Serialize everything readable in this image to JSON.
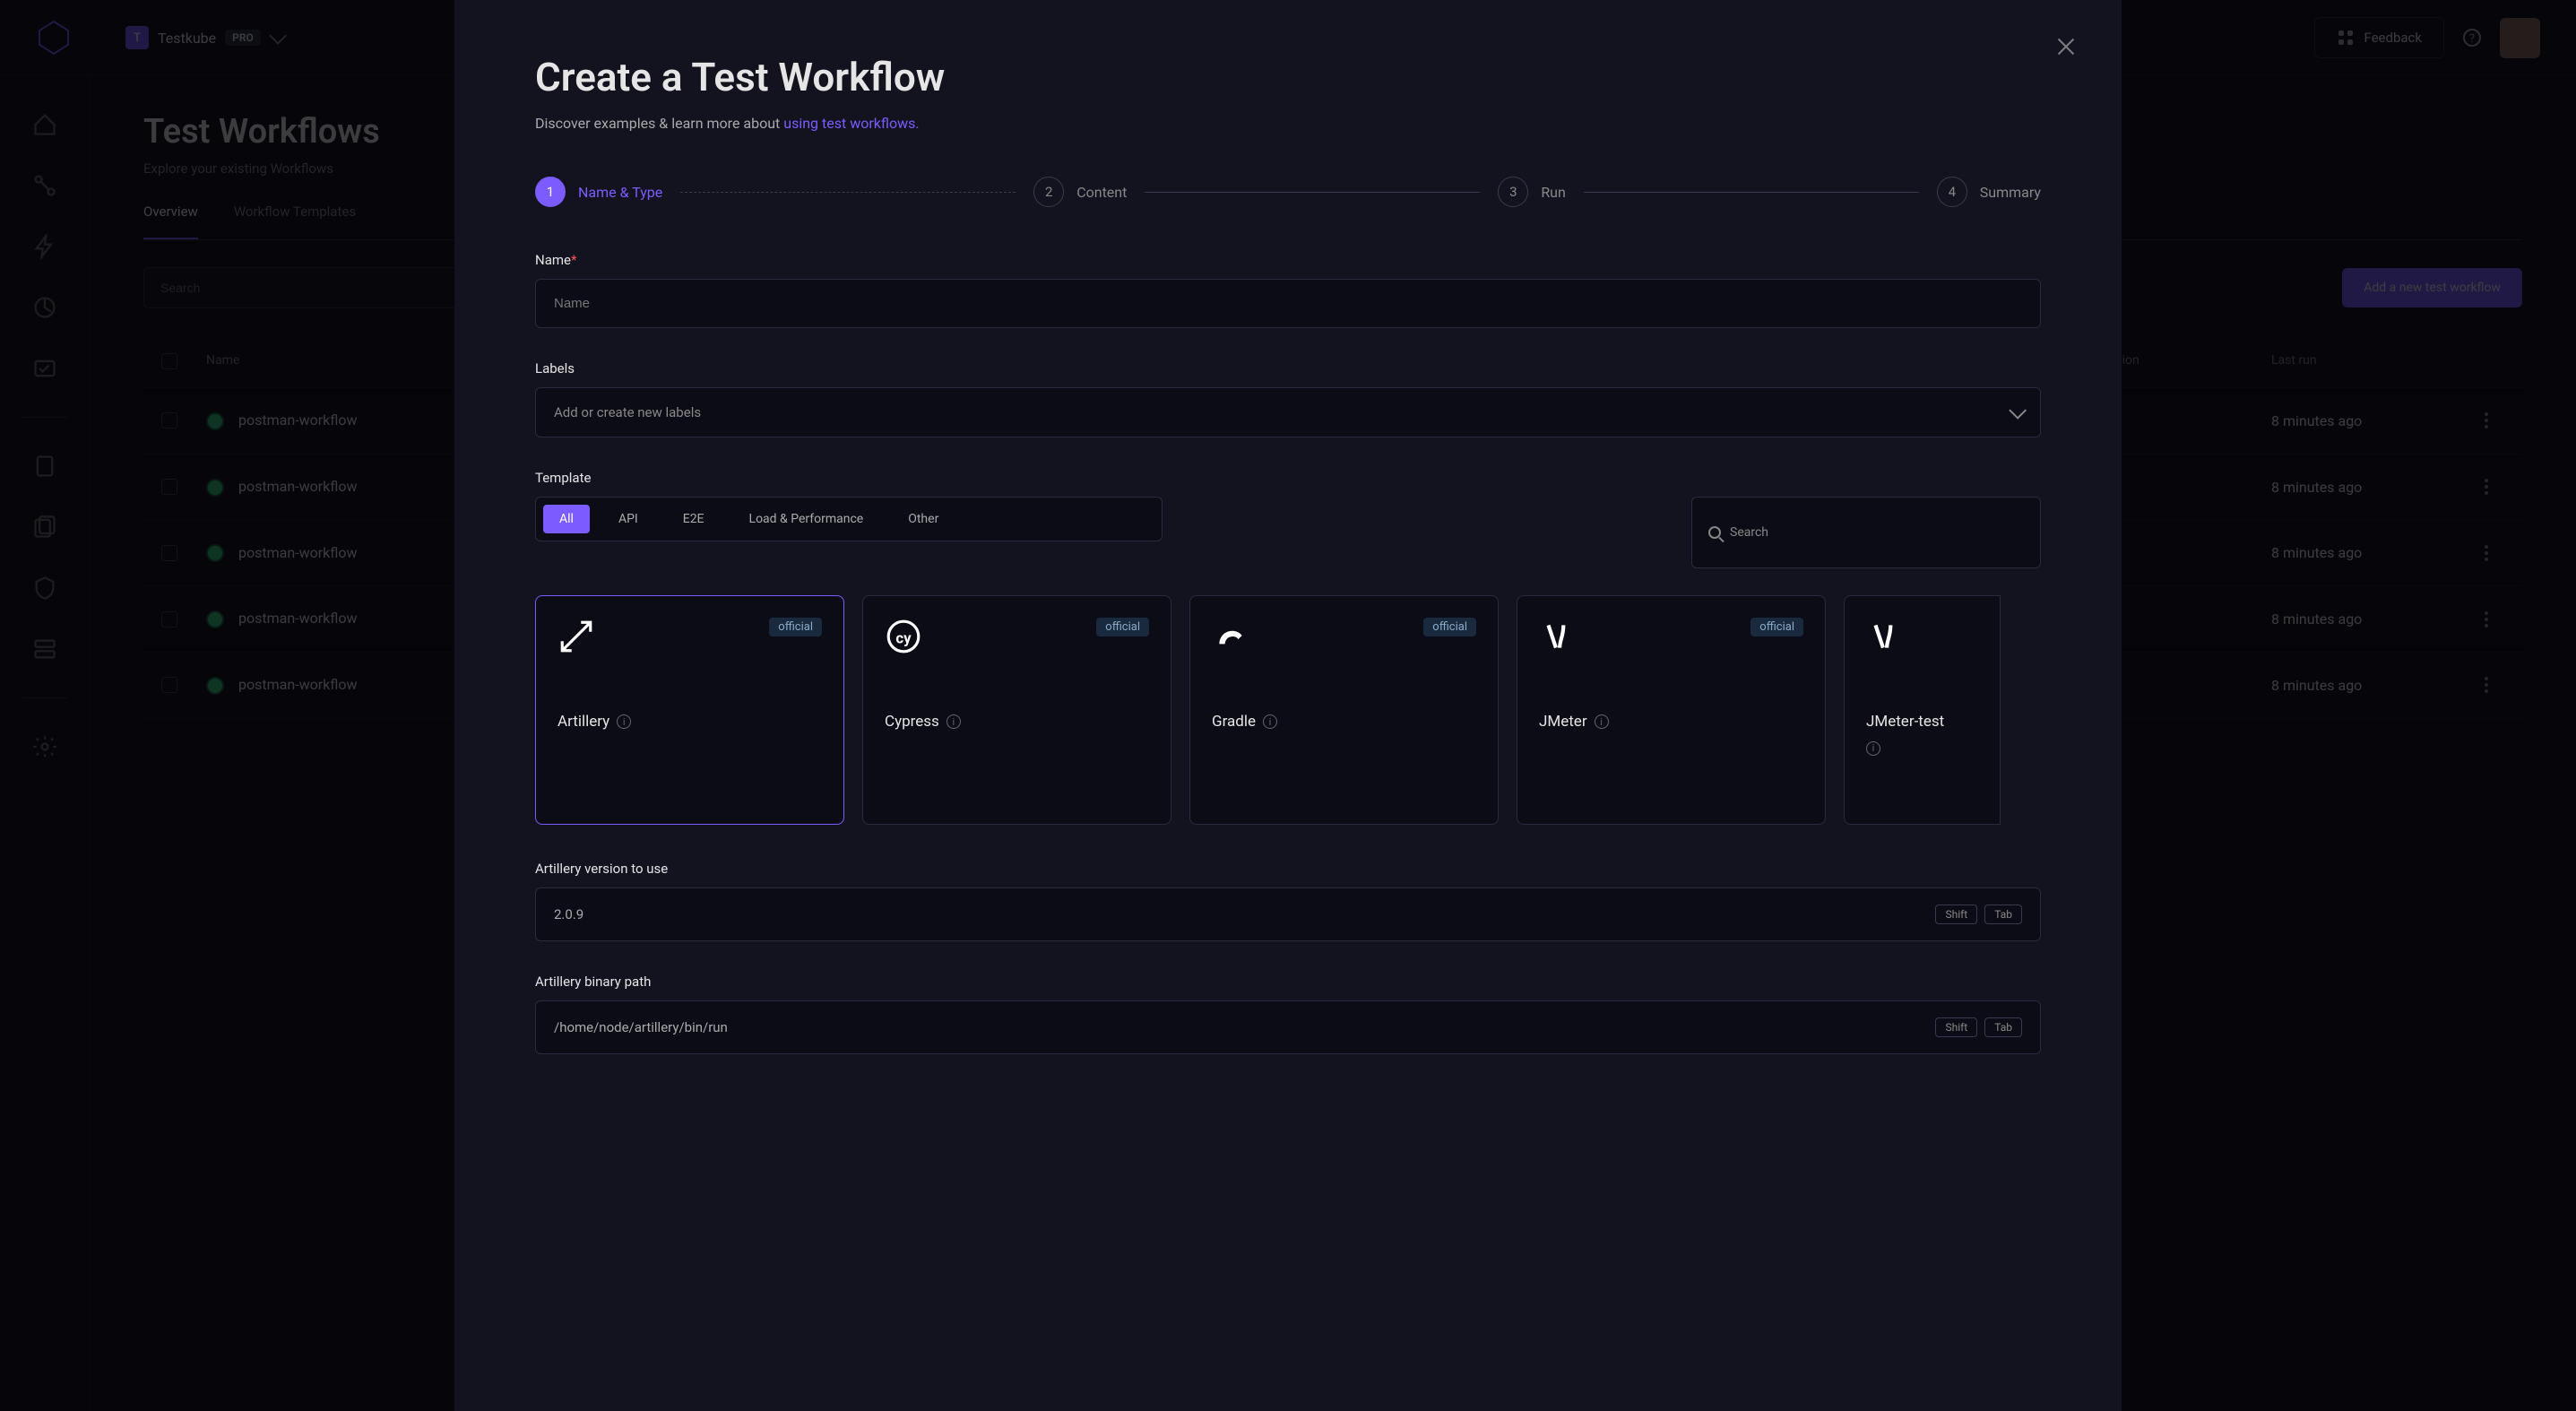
{
  "topbar": {
    "org_initial": "T",
    "org_name": "Testkube",
    "pro_label": "PRO",
    "feedback_label": "Feedback"
  },
  "page": {
    "title": "Test Workflows",
    "subtitle": "Explore your existing Workflows",
    "tabs": {
      "overview": "Overview",
      "templates": "Workflow Templates"
    },
    "search_placeholder": "Search",
    "add_button": "Add a new test workflow"
  },
  "table": {
    "headers": {
      "name": "Name",
      "duration": "Duration",
      "last_run": "Last run"
    },
    "rows": [
      {
        "name": "postman-workflow",
        "last_run": "8 minutes ago"
      },
      {
        "name": "postman-workflow",
        "last_run": "8 minutes ago"
      },
      {
        "name": "postman-workflow",
        "last_run": "8 minutes ago"
      },
      {
        "name": "postman-workflow",
        "last_run": "8 minutes ago"
      },
      {
        "name": "postman-workflow",
        "last_run": "8 minutes ago"
      }
    ]
  },
  "modal": {
    "title": "Create a Test Workflow",
    "subtitle_prefix": "Discover examples & learn more about ",
    "subtitle_link": "using test workflows.",
    "steps": [
      {
        "num": "1",
        "label": "Name & Type"
      },
      {
        "num": "2",
        "label": "Content"
      },
      {
        "num": "3",
        "label": "Run"
      },
      {
        "num": "4",
        "label": "Summary"
      }
    ],
    "name_label": "Name",
    "name_placeholder": "Name",
    "labels_label": "Labels",
    "labels_placeholder": "Add or create new labels",
    "template_label": "Template",
    "template_filters": {
      "all": "All",
      "api": "API",
      "e2e": "E2E",
      "load": "Load & Performance",
      "other": "Other"
    },
    "template_search_placeholder": "Search",
    "templates": [
      {
        "name": "Artillery",
        "official": "official"
      },
      {
        "name": "Cypress",
        "official": "official"
      },
      {
        "name": "Gradle",
        "official": "official"
      },
      {
        "name": "JMeter",
        "official": "official"
      },
      {
        "name": "JMeter-test",
        "official": ""
      }
    ],
    "version_label": "Artillery version to use",
    "version_value": "2.0.9",
    "binary_label": "Artillery binary path",
    "binary_value": "/home/node/artillery/bin/run",
    "kbd_shift": "Shift",
    "kbd_tab": "Tab"
  }
}
